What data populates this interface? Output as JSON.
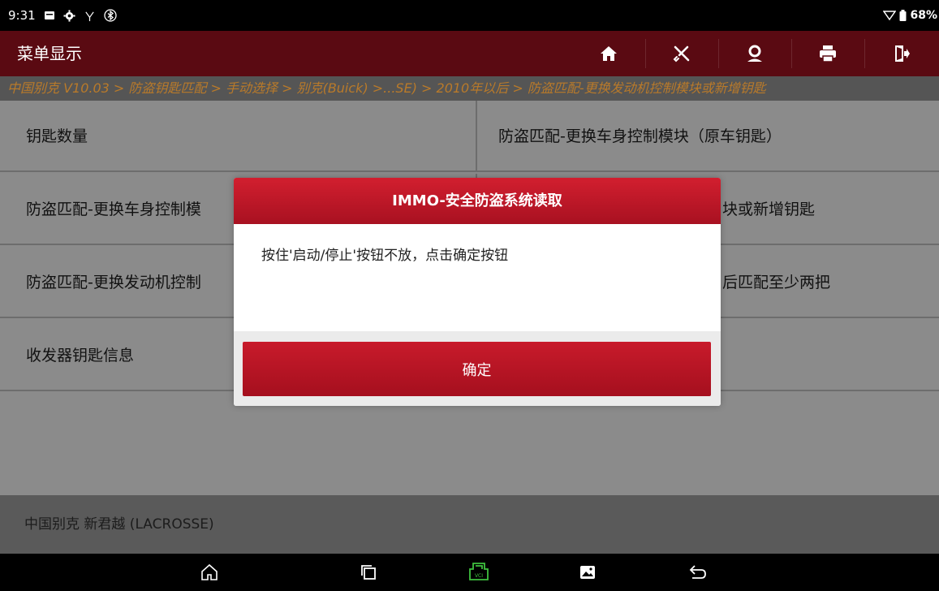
{
  "status_bar": {
    "time": "9:31",
    "battery": "68%"
  },
  "header": {
    "title": "菜单显示",
    "buttons": [
      "home-icon",
      "tools-icon",
      "user-icon",
      "print-icon",
      "exit-icon"
    ]
  },
  "breadcrumb": "中国别克 V10.03 > 防盗钥匙匹配 > 手动选择 > 别克(Buick) >...SE) > 2010年以后 > 防盗匹配-更换发动机控制模块或新增钥匙",
  "menu": {
    "left": [
      "钥匙数量",
      "防盗匹配-更换车身控制模",
      "防盗匹配-更换发动机控制",
      "收发器钥匙信息"
    ],
    "right": [
      "防盗匹配-更换车身控制模块（原车钥匙）",
      "块或新增钥匙",
      "后匹配至少两把",
      ""
    ]
  },
  "footer": {
    "vehicle": "中国别克 新君越 (LACROSSE)"
  },
  "dialog": {
    "title": "IMMO-安全防盗系统读取",
    "message": "按住'启动/停止'按钮不放，点击确定按钮",
    "ok_label": "确定"
  },
  "nav": {
    "icons": [
      "home-outline-icon",
      "recent-apps-icon",
      "vci-icon",
      "gallery-icon",
      "back-icon"
    ]
  },
  "colors": {
    "title_bar": "#5a0a12",
    "dialog_red": "#c81b2b",
    "breadcrumb_text": "#b97a2a",
    "vci_green": "#3fc13f"
  }
}
